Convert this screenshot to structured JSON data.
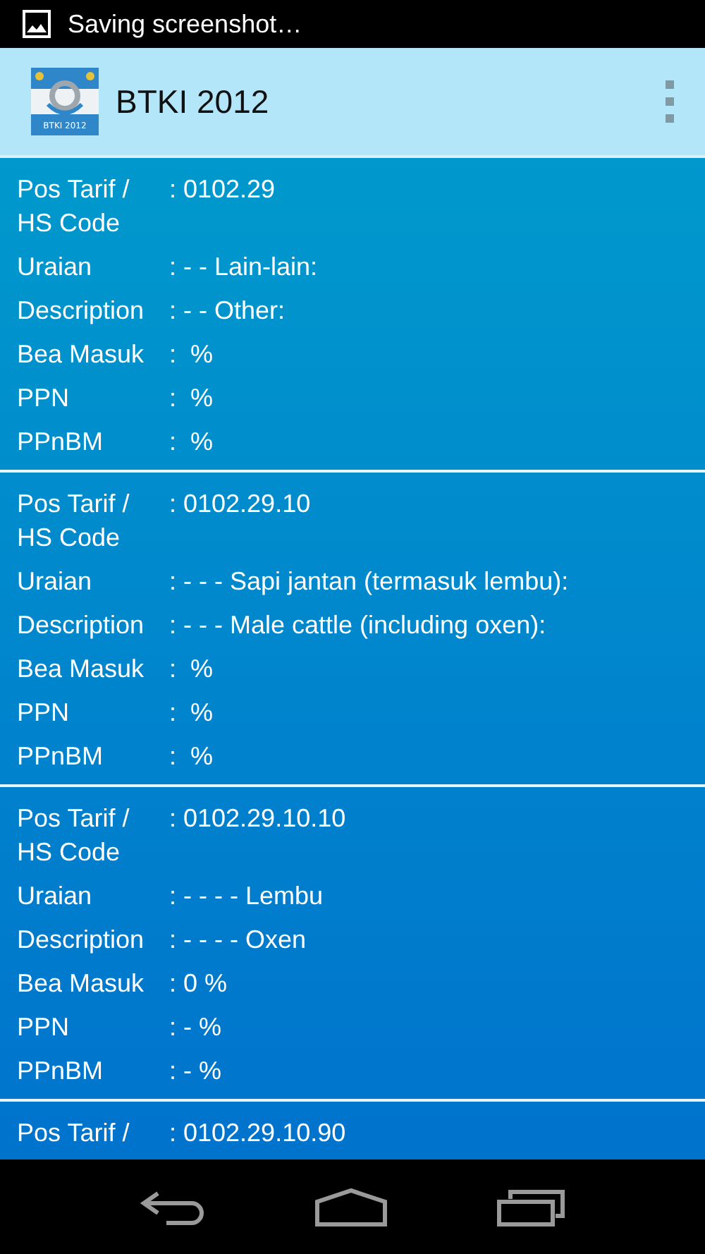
{
  "status_bar": {
    "notification": "Saving screenshot…"
  },
  "app_bar": {
    "title": "BTKI 2012",
    "logo_text": "BTKI 2012"
  },
  "entries": [
    {
      "fields": [
        {
          "label": "Pos Tarif / HS Code",
          "value": ": 0102.29"
        },
        {
          "label": "Uraian",
          "value": ": - - Lain-lain:"
        },
        {
          "label": "Description",
          "value": ": - - Other:"
        },
        {
          "label": "Bea Masuk",
          "value": ":  %"
        },
        {
          "label": "PPN",
          "value": ":  %"
        },
        {
          "label": "PPnBM",
          "value": ":  %"
        }
      ]
    },
    {
      "fields": [
        {
          "label": "Pos Tarif / HS Code",
          "value": ": 0102.29.10"
        },
        {
          "label": "Uraian",
          "value": ": - - - Sapi jantan (termasuk lembu):"
        },
        {
          "label": "Description",
          "value": ": - - - Male cattle (including oxen):"
        },
        {
          "label": "Bea Masuk",
          "value": ":  %"
        },
        {
          "label": "PPN",
          "value": ":  %"
        },
        {
          "label": "PPnBM",
          "value": ":  %"
        }
      ]
    },
    {
      "fields": [
        {
          "label": "Pos Tarif / HS Code",
          "value": ": 0102.29.10.10"
        },
        {
          "label": "Uraian",
          "value": ": - - - - Lembu"
        },
        {
          "label": "Description",
          "value": ": - - - - Oxen"
        },
        {
          "label": "Bea Masuk",
          "value": ": 0 %"
        },
        {
          "label": "PPN",
          "value": ": - %"
        },
        {
          "label": "PPnBM",
          "value": ": - %"
        }
      ]
    },
    {
      "fields": [
        {
          "label": "Pos Tarif /",
          "value": ": 0102.29.10.90"
        }
      ]
    }
  ]
}
